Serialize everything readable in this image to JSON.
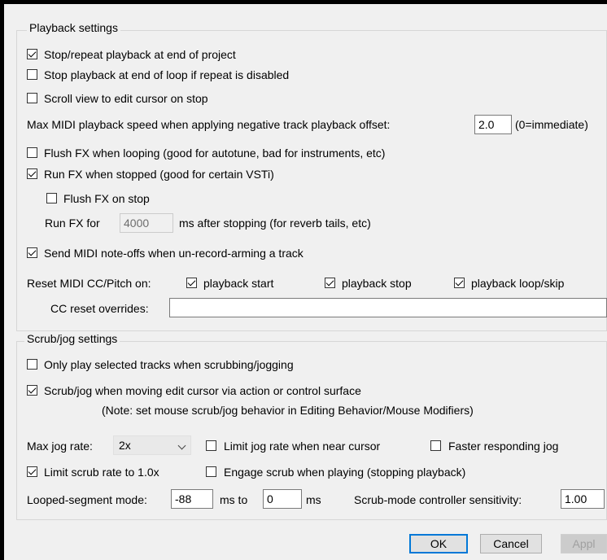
{
  "playback": {
    "title": "Playback settings",
    "stop_repeat": {
      "label": "Stop/repeat playback at end of project",
      "checked": true
    },
    "stop_end_loop": {
      "label": "Stop playback at end of loop if repeat is disabled",
      "checked": false
    },
    "scroll_view": {
      "label": "Scroll view to edit cursor on stop",
      "checked": false
    },
    "max_midi_label": "Max MIDI playback speed when applying negative track playback offset:",
    "max_midi_value": "2.0",
    "max_midi_hint": "(0=immediate)",
    "flush_fx_looping": {
      "label": "Flush FX when looping (good for autotune, bad for instruments, etc)",
      "checked": false
    },
    "run_fx_stopped": {
      "label": "Run FX when stopped (good for certain VSTi)",
      "checked": true
    },
    "flush_fx_stop": {
      "label": "Flush FX on stop",
      "checked": false
    },
    "run_fx_for_label": "Run FX for",
    "run_fx_for_value": "4000",
    "run_fx_for_suffix": "ms after stopping (for reverb tails, etc)",
    "send_midi_noteoffs": {
      "label": "Send MIDI note-offs when un-record-arming a track",
      "checked": true
    },
    "reset_midi_label": "Reset MIDI CC/Pitch on:",
    "reset_start": {
      "label": "playback start",
      "checked": true
    },
    "reset_stop": {
      "label": "playback stop",
      "checked": true
    },
    "reset_loop": {
      "label": "playback loop/skip",
      "checked": true
    },
    "cc_reset_label": "CC reset overrides:",
    "cc_reset_value": ""
  },
  "scrub": {
    "title": "Scrub/jog settings",
    "only_selected": {
      "label": "Only play selected tracks when scrubbing/jogging",
      "checked": false
    },
    "scrub_moving": {
      "label": "Scrub/jog when moving edit cursor via action or control surface",
      "checked": true
    },
    "note": "(Note: set mouse scrub/jog behavior in Editing Behavior/Mouse Modifiers)",
    "max_jog_label": "Max jog rate:",
    "max_jog_value": "2x",
    "limit_jog_near": {
      "label": "Limit jog rate when near cursor",
      "checked": false
    },
    "faster_jog": {
      "label": "Faster responding jog",
      "checked": false
    },
    "limit_scrub": {
      "label": "Limit scrub rate to 1.0x",
      "checked": true
    },
    "engage_scrub": {
      "label": "Engage scrub when playing (stopping playback)",
      "checked": false
    },
    "looped_label": "Looped-segment mode:",
    "looped_from": "-88",
    "looped_mid": "ms to",
    "looped_to": "0",
    "looped_unit": "ms",
    "sensitivity_label": "Scrub-mode controller sensitivity:",
    "sensitivity_value": "1.00"
  },
  "buttons": {
    "ok": "OK",
    "cancel": "Cancel",
    "apply": "Appl"
  }
}
